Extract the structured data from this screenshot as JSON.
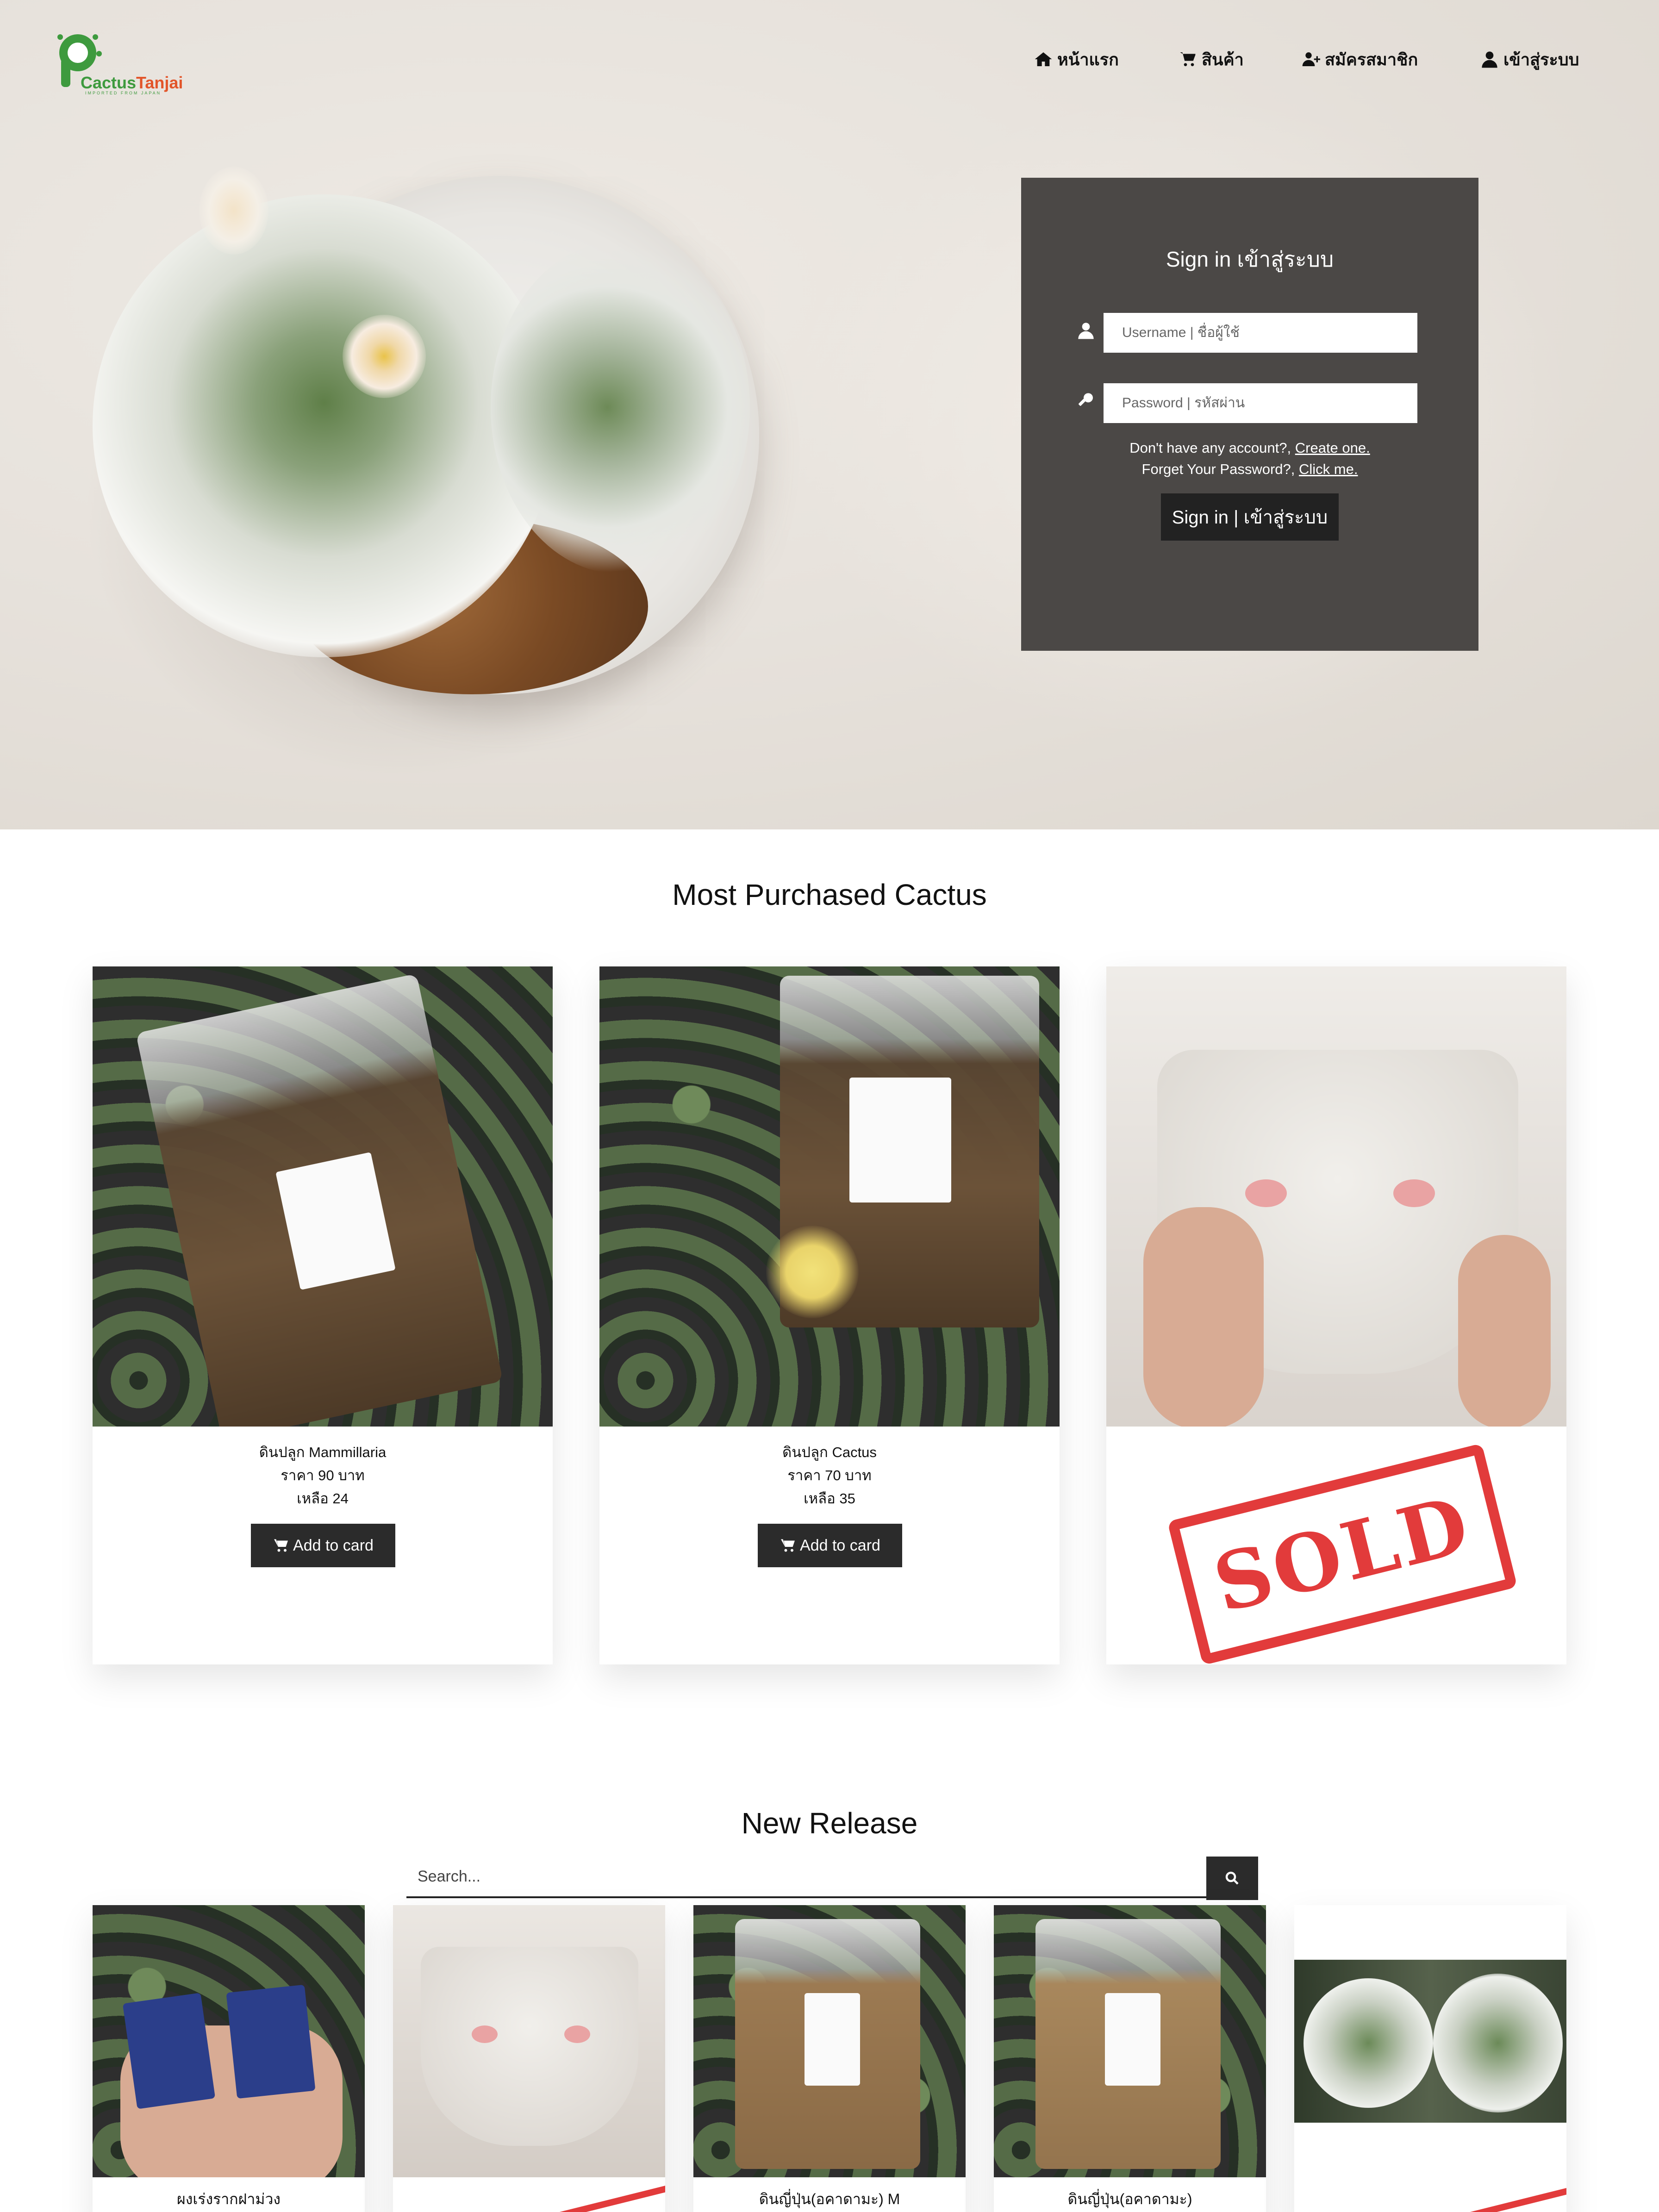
{
  "brand": {
    "name_part1": "Cactus",
    "name_part2": "Tanjai",
    "tagline": "IMPORTED FROM JAPAN"
  },
  "nav": {
    "items": [
      {
        "label": "หน้าแรก",
        "icon": "home-icon"
      },
      {
        "label": "สินค้า",
        "icon": "cart-icon"
      },
      {
        "label": "สมัครสมาชิก",
        "icon": "user-plus-icon"
      },
      {
        "label": "เข้าสู่ระบบ",
        "icon": "user-icon"
      }
    ]
  },
  "signin": {
    "title": "Sign in เข้าสู่ระบบ",
    "username_placeholder": "Username | ชื่อผู้ใช้",
    "password_placeholder": "Password | รหัสผ่าน",
    "no_account_text": "Don't have any account?,",
    "create_link": "Create one.",
    "forget_text": "Forget Your Password?,",
    "click_link": "Click me.",
    "button": "Sign in | เข้าสู่ระบบ"
  },
  "most_purchased": {
    "title": "Most Purchased Cactus",
    "products": [
      {
        "name": "ดินปลูก Mammillaria",
        "price": "ราคา 90 บาท",
        "stock": "เหลือ 24",
        "button": "Add to card"
      },
      {
        "name": "ดินปลูก Cactus",
        "price": "ราคา 70 บาท",
        "stock": "เหลือ 35",
        "button": "Add to card"
      },
      {
        "sold_label": "SOLD"
      }
    ]
  },
  "new_release": {
    "title": "New Release",
    "search_placeholder": "Search...",
    "products": [
      {
        "name": "ผงเร่งรากฝาม่วง"
      },
      {
        "name": ""
      },
      {
        "name": "ดินญี่ปุ่น(อคาดามะ) M"
      },
      {
        "name": "ดินญี่ปุ่น(อคาดามะ)"
      },
      {
        "name": ""
      }
    ]
  },
  "colors": {
    "brand_green": "#3e9a3e",
    "brand_orange": "#e2552a",
    "signin_panel": "#4b4846",
    "button_dark": "#2b2b2b",
    "sold_red": "#e23b3b"
  }
}
